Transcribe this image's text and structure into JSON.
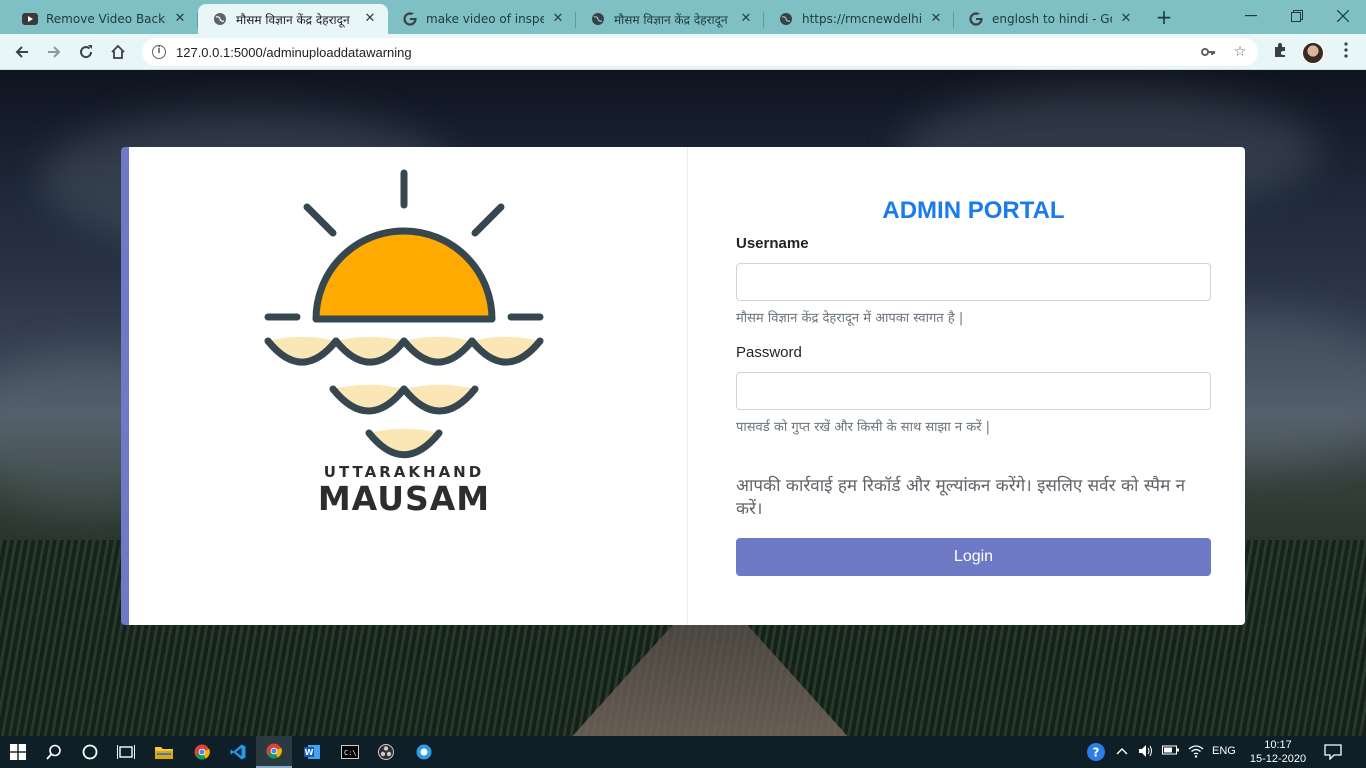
{
  "browser": {
    "tabs": [
      {
        "title": "Remove Video Backgro",
        "icon": "youtube-icon"
      },
      {
        "title": "मौसम विज्ञान केंद्र देहरादून",
        "icon": "globe-icon",
        "active": true
      },
      {
        "title": "make video of inspect e",
        "icon": "google-icon"
      },
      {
        "title": "मौसम विज्ञान केंद्र देहरादून",
        "icon": "globe-icon"
      },
      {
        "title": "https://rmcnewdelhi.im",
        "icon": "globe-icon"
      },
      {
        "title": "englosh to hindi - Goog",
        "icon": "google-icon"
      }
    ],
    "url": "127.0.0.1:5000/adminuploaddatawarning"
  },
  "logo": {
    "line1": "UTTARAKHAND",
    "line2": "MAUSAM",
    "sun_color": "#FFAA00",
    "wave_color": "#FBE7B5",
    "stroke_color": "#37474F"
  },
  "form": {
    "title": "ADMIN PORTAL",
    "username_label": "Username",
    "username_help": "मौसम विज्ञान केंद्र देहरादून में आपका स्वागत है |",
    "password_label": "Password",
    "password_help": "पासवर्ड को गुप्त रखें और किसी के साथ साझा न करें |",
    "warning": "आपकी कार्रवाई हम रिकॉर्ड और मूल्यांकन करेंगे। इसलिए सर्वर को स्पैम न करें।",
    "login_label": "Login",
    "accent_color": "#1A7BEC",
    "button_color": "#6F7AC7"
  },
  "taskbar": {
    "language": "ENG",
    "time": "10:17",
    "date": "15-12-2020"
  }
}
